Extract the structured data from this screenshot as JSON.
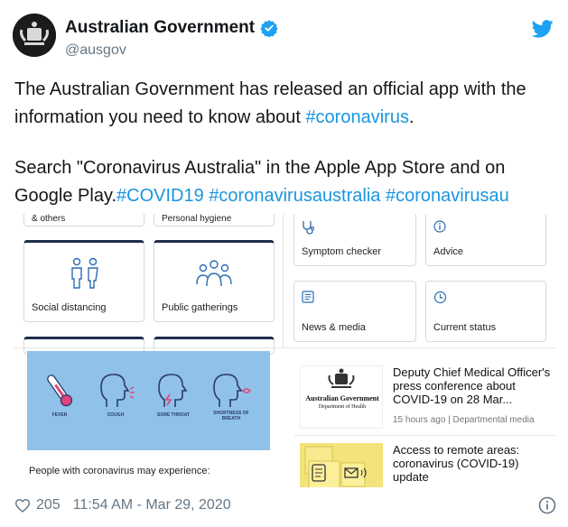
{
  "author": {
    "name": "Australian Government",
    "handle": "@ausgov"
  },
  "tweet": {
    "line1_before": "The Australian Government has released an official app with the information you need to know about ",
    "line1_tag": "#coronavirus",
    "line1_after": ".",
    "line2_before": "Search \"Coronavirus Australia\" in the Apple App Store and on Google Play.",
    "tags": [
      "#COVID19",
      "#coronavirusaustralia",
      "#coronavirusau"
    ]
  },
  "media": {
    "top_left_cards": {
      "cut_labels": [
        "& others",
        "Personal hygiene"
      ],
      "labels": [
        "Social distancing",
        "Public gatherings"
      ]
    },
    "top_right_cards": [
      "Symptom checker",
      "Advice",
      "News & media",
      "Current status"
    ],
    "symptoms": [
      "FEVER",
      "COUGH",
      "SORE THROAT",
      "SHORTNESS OF BREATH"
    ],
    "experience_text": "People with coronavirus may experience:",
    "news": [
      {
        "title": "Deputy Chief Medical Officer's press conference about COVID-19 on 28 Mar...",
        "meta": "15 hours ago | Departmental media",
        "logo_line1": "Australian Government",
        "logo_line2": "Department of Health"
      },
      {
        "title": "Access to remote areas: coronavirus (COVID-19) update"
      }
    ]
  },
  "footer": {
    "likes": "205",
    "timestamp": "11:54 AM - Mar 29, 2020"
  },
  "icons": {
    "verified": "verified-badge-icon",
    "bird": "twitter-bird-icon",
    "heart": "heart-icon",
    "info": "info-icon"
  },
  "colors": {
    "link": "#1b95e0",
    "verified": "#1da1f2",
    "fever_panel": "#8fc1e9",
    "card_accent": "#1f2d4a"
  }
}
